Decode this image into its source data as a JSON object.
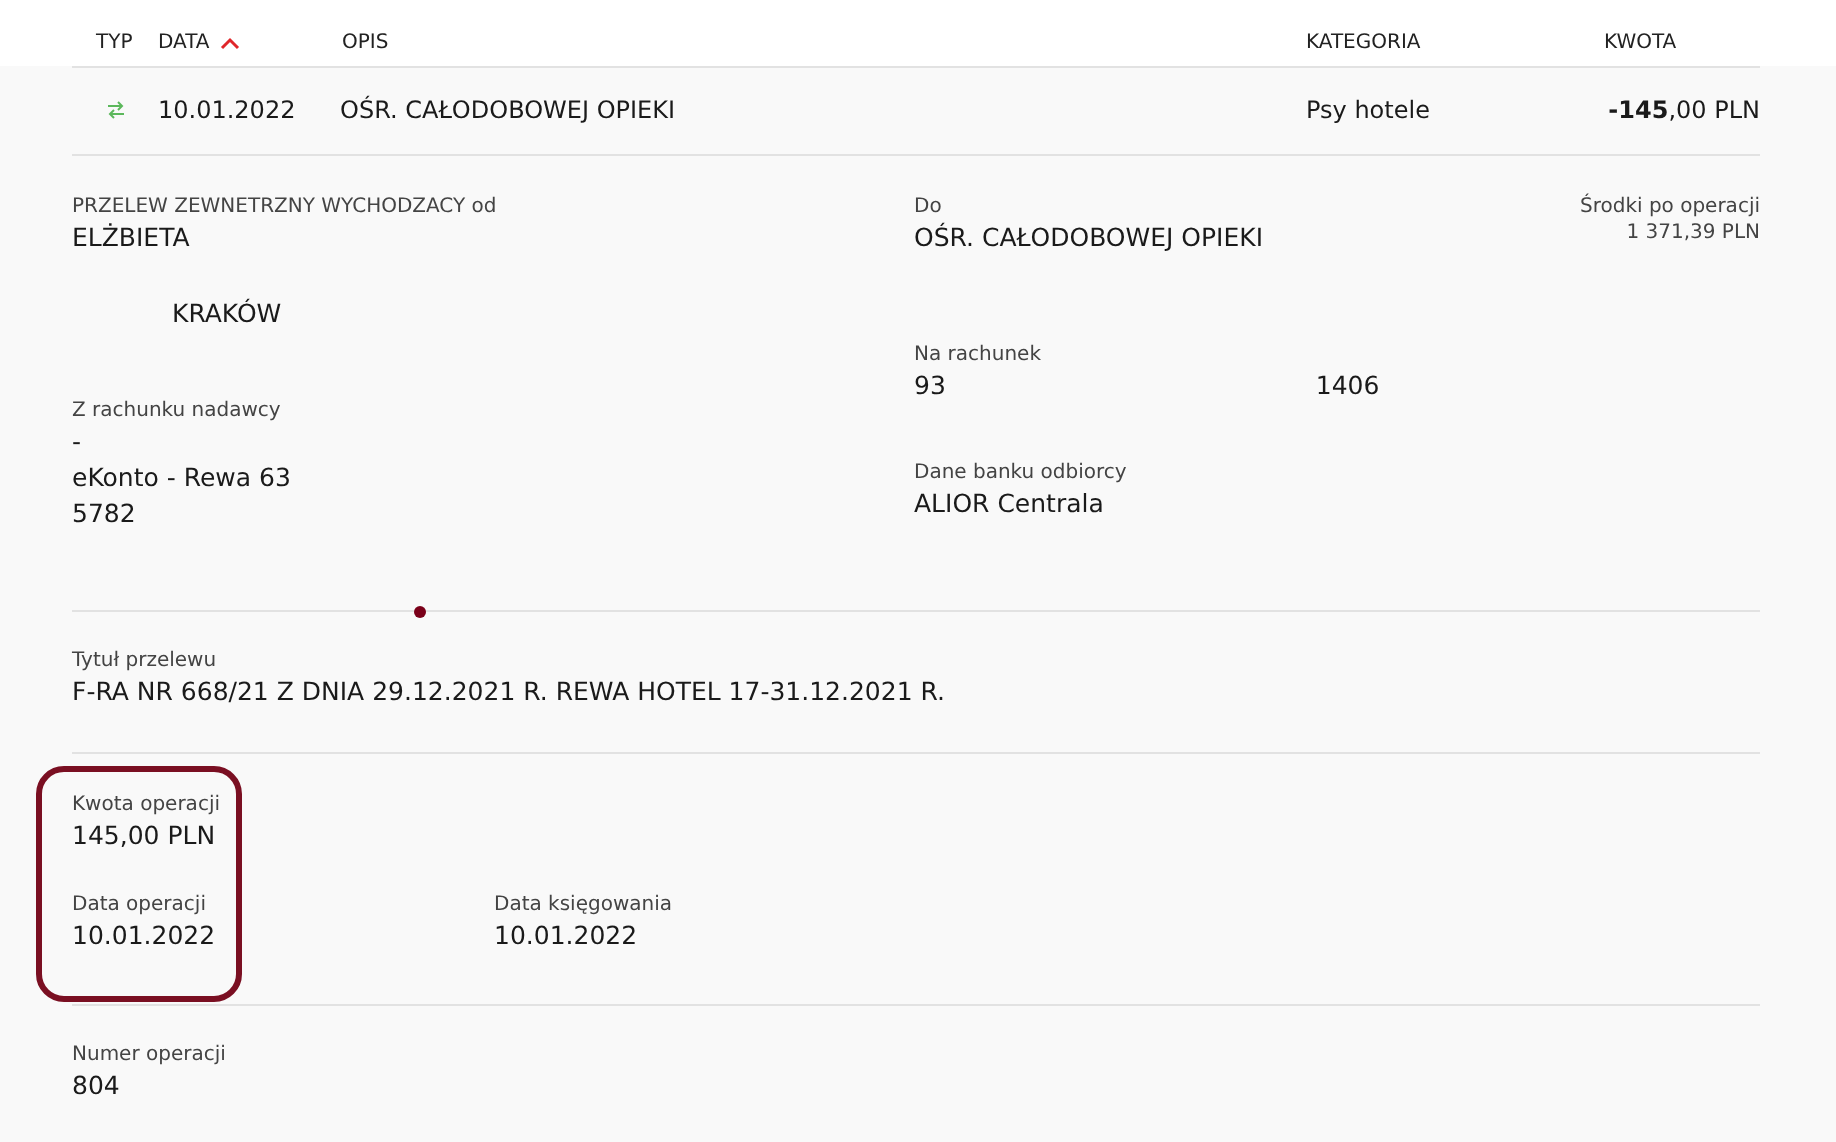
{
  "table": {
    "columns": [
      {
        "label": "TYP",
        "sorted_ascending": false
      },
      {
        "label": "DATA",
        "sorted_ascending": true
      },
      {
        "label": "OPIS",
        "sorted_ascending": false
      },
      {
        "label": "KATEGORIA",
        "sorted_ascending": false
      },
      {
        "label": "KWOTA",
        "sorted_ascending": false
      }
    ],
    "row": {
      "date": "10.01.2022",
      "description": "OŚR. CAŁODOBOWEJ OPIEKI",
      "category": "Psy hotele",
      "amount": "**-145**,00 PLN"
    }
  },
  "details": {
    "sender": {
      "label": "PRZELEW ZEWNETRZNY WYCHODZACY od",
      "lines": [
        "ELŻBIETA",
        "KRAKÓW"
      ]
    },
    "recipient": {
      "label": "Do",
      "lines": [
        "OŚR. CAŁODOBOWEJ OPIEKI"
      ]
    },
    "balance": {
      "label": "Środki po operacji",
      "value": "1 371,39 PLN"
    },
    "from_account": {
      "label": "Z rachunku nadawcy",
      "lines": [
        "-",
        "eKonto - Rewa 63",
        "5782"
      ]
    },
    "to_account": {
      "label": "Na rachunek",
      "value_start": "93",
      "value_end": "1406"
    },
    "bank": {
      "label": "Dane banku odbiorcy",
      "value": "ALIOR Centrala"
    },
    "title": {
      "label": "Tytuł przelewu",
      "value": "F-RA NR 668/21 Z DNIA 29.12.2021 R. REWA HOTEL 17-31.12.2021 R."
    },
    "amount": {
      "label": "Kwota operacji",
      "value": "145,00 PLN"
    },
    "operation_date": {
      "label": "Data operacji",
      "value": "10.01.2022"
    },
    "booking_date": {
      "label": "Data księgowania",
      "value": "10.01.2022"
    },
    "number": {
      "label": "Numer operacji",
      "value": "804"
    }
  }
}
